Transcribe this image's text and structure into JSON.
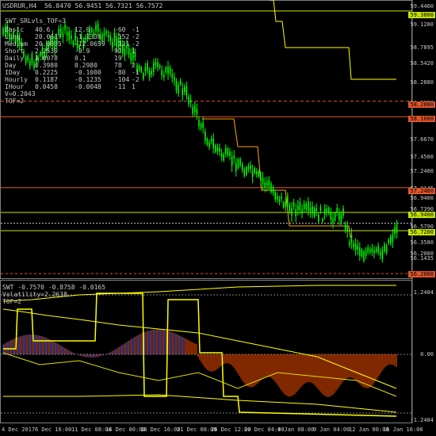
{
  "header": {
    "symbol_line": "USDRUR,H4  56.8470 56.9451 56.7321 56.7572",
    "indicator_name": "SWT_SRLvls_TOF=3"
  },
  "info_table": [
    {
      "label": "Basic",
      "c1": "40.6",
      "c2": "12.0",
      "c3": "-60",
      "c4": "-1"
    },
    {
      "label": "Long",
      "c1": "20.0617",
      "c2": "-1.1336",
      "c3": "-152",
      "c4": "-2"
    },
    {
      "label": "Medium",
      "c1": "20.0035",
      "c3": "-121",
      "c4": "-2",
      "c2": "-12.0659"
    },
    {
      "label": "Short",
      "c1": "2.2539",
      "c2": "-0.9",
      "c3": "91",
      "c4": "1"
    },
    {
      "label": "Daily",
      "c1": "1.0078",
      "c2": "0.1",
      "c3": "19",
      "c4": ""
    },
    {
      "label": "Day",
      "c1": "0.3980",
      "c2": "0.2980",
      "c3": "78",
      "c4": "2"
    },
    {
      "label": "IDay",
      "c1": "0.2225",
      "c2": "-0.1000",
      "c3": "-80",
      "c4": "-1"
    },
    {
      "label": "Hourly",
      "c1": "0.1187",
      "c2": "-0.1235",
      "c3": "-104",
      "c4": "-2"
    },
    {
      "label": "IHour",
      "c1": "0.0458",
      "c2": "-0.0048",
      "c3": "-11",
      "c4": "1"
    }
  ],
  "v_value": "V=0.2043",
  "tof_value": "TOF=2",
  "price_axis": [
    "59.4460",
    "59.3800",
    "59.1280",
    "58.7895",
    "58.5420",
    "58.2880",
    "58.1000",
    "57.8855",
    "57.6670",
    "57.4500",
    "57.2400",
    "57.0145",
    "56.9400",
    "56.7390",
    "56.7200",
    "56.5790",
    "56.3580",
    "56.2000",
    "56.1435"
  ],
  "price_tags": [
    {
      "text": "59.3800",
      "color": "#c8e400"
    },
    {
      "text": "58.2880",
      "color": "#e0552b"
    },
    {
      "text": "58.1000",
      "color": "#e0552b"
    },
    {
      "text": "57.2400",
      "color": "#e0552b"
    },
    {
      "text": "56.9400",
      "color": "#c8e400"
    },
    {
      "text": "56.7200",
      "color": "#c8e400"
    },
    {
      "text": "56.2000",
      "color": "#e0552b"
    }
  ],
  "sub_header": {
    "line1": "SWT -0.7570 -0.8758 -0.0165",
    "line2": "Volatility=2.2638",
    "line3": "TOF=2"
  },
  "sub_axis": [
    "1.2404",
    "0.00",
    "-1.2404"
  ],
  "time_axis": [
    "4 Dec 2017",
    "6 Dec 16:00",
    "11 Dec 08:00",
    "14 Dec 00:00",
    "18 Dec 16:00",
    "21 Dec 08:00",
    "26 Dec 12:00",
    "29 Dec 04:00",
    "4 Jan 08:00",
    "9 Jan 04:00",
    "12 Jan 00:00",
    "16 Jan 16:00"
  ],
  "colors": {
    "background": "#000000",
    "candle": "#00ff00",
    "level_green": "#c8e400",
    "level_red": "#e0552b",
    "yellow": "#ffff00",
    "blue_hist": "#4060ff",
    "red_hist": "#ff5000"
  }
}
